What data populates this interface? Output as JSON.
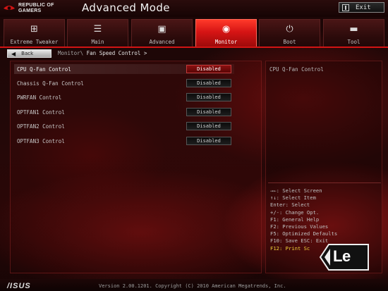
{
  "header": {
    "brand_line1": "REPUBLIC OF",
    "brand_line2": "GAMERS",
    "mode_title": "Advanced Mode",
    "exit_label": "Exit"
  },
  "tabs": [
    {
      "label": "Extreme Tweaker",
      "icon": "chip-icon",
      "glyph": "⊞"
    },
    {
      "label": "Main",
      "icon": "list-icon",
      "glyph": "☰"
    },
    {
      "label": "Advanced",
      "icon": "advanced-icon",
      "glyph": "▣"
    },
    {
      "label": "Monitor",
      "icon": "monitor-icon",
      "glyph": "◉",
      "active": true
    },
    {
      "label": "Boot",
      "icon": "power-icon",
      "glyph": "⏻"
    },
    {
      "label": "Tool",
      "icon": "tool-icon",
      "glyph": "▬"
    }
  ],
  "nav": {
    "back_label": "Back",
    "breadcrumb_parent": "Monitor\\",
    "breadcrumb_current": "Fan Speed Control >"
  },
  "settings": [
    {
      "label": "CPU Q-Fan Control",
      "value": "Disabled",
      "selected": true
    },
    {
      "label": "Chassis Q-Fan Control",
      "value": "Disabled"
    },
    {
      "label": "PWRFAN Control",
      "value": "Disabled"
    },
    {
      "label": "OPTFAN1 Control",
      "value": "Disabled"
    },
    {
      "label": "OPTFAN2 Control",
      "value": "Disabled"
    },
    {
      "label": "OPTFAN3 Control",
      "value": "Disabled"
    }
  ],
  "help": {
    "description": "CPU Q-Fan Control"
  },
  "keys": [
    "→←: Select Screen",
    "↑↓: Select Item",
    "Enter: Select",
    "+/-: Change Opt.",
    "F1: General Help",
    "F2: Previous Values",
    "F5: Optimized Defaults",
    "F10: Save  ESC: Exit",
    "F12: Print Sc"
  ],
  "watermark": "Le",
  "footer": {
    "logo": "/ISUS",
    "version": "Version 2.00.1201. Copyright (C) 2010 American Megatrends, Inc."
  },
  "colors": {
    "accent_red": "#d21414",
    "highlight_yellow": "#f0d23a"
  }
}
